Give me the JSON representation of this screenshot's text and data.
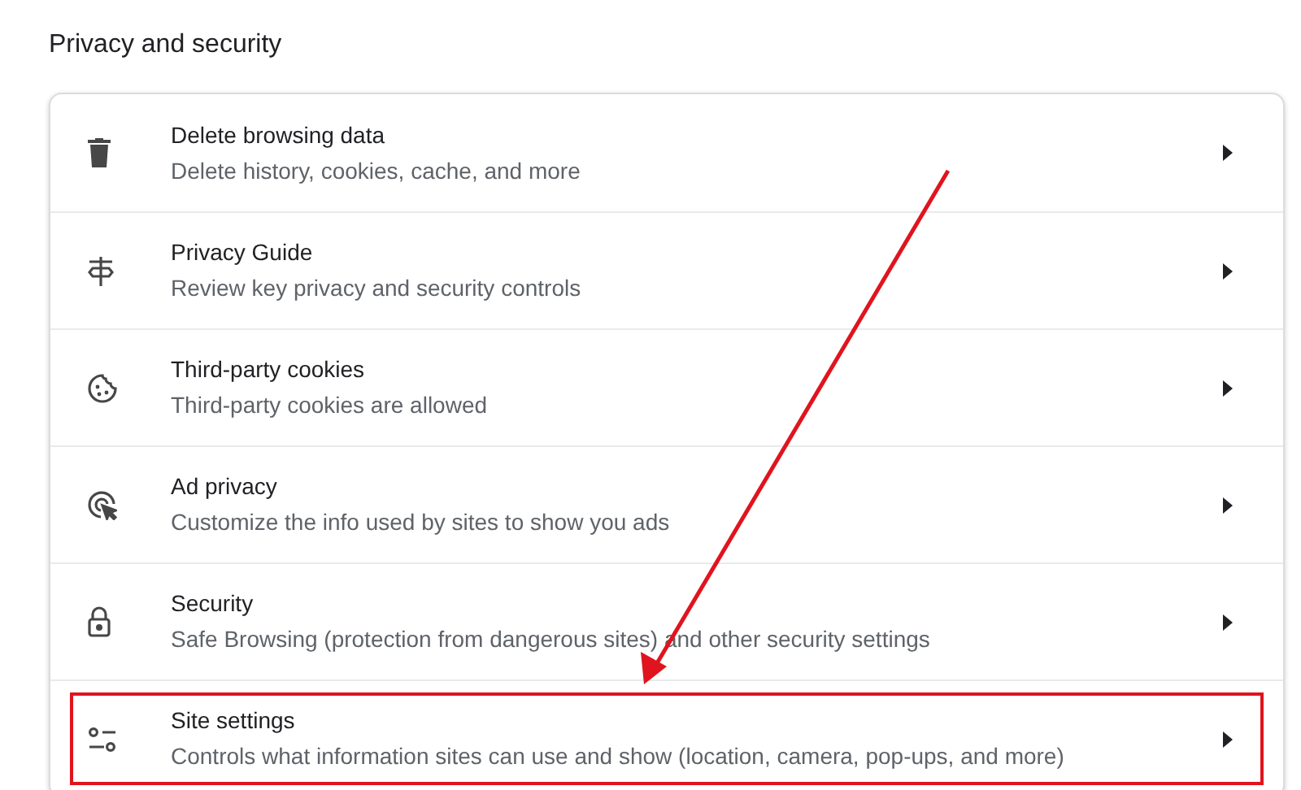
{
  "section_title": "Privacy and security",
  "rows": [
    {
      "title": "Delete browsing data",
      "subtitle": "Delete history, cookies, cache, and more",
      "highlighted": false
    },
    {
      "title": "Privacy Guide",
      "subtitle": "Review key privacy and security controls",
      "highlighted": false
    },
    {
      "title": "Third-party cookies",
      "subtitle": "Third-party cookies are allowed",
      "highlighted": false
    },
    {
      "title": "Ad privacy",
      "subtitle": "Customize the info used by sites to show you ads",
      "highlighted": false
    },
    {
      "title": "Security",
      "subtitle": "Safe Browsing (protection from dangerous sites) and other security settings",
      "highlighted": false
    },
    {
      "title": "Site settings",
      "subtitle": "Controls what information sites can use and show (location, camera, pop-ups, and more)",
      "highlighted": true
    }
  ]
}
